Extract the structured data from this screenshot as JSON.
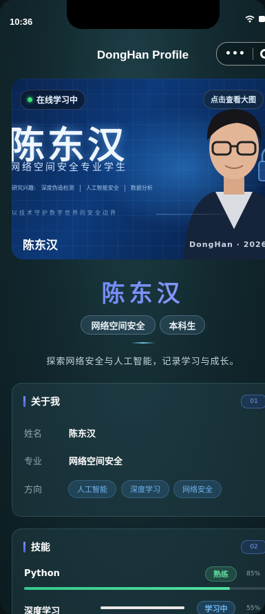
{
  "status_bar": {
    "time": "10:36",
    "icons": [
      "wifi-icon",
      "battery-icon"
    ]
  },
  "nav": {
    "title": "DongHan Profile",
    "menu_icon": "more-dots-icon",
    "close_icon": "target-icon"
  },
  "banner": {
    "status_badge": "在线学习中",
    "view_button": "点击查看大图",
    "big_name": "陈东汉",
    "subtitle": "网络空间安全专业学生",
    "interests_label": "研究兴趣:",
    "interests": [
      "深度伪造检测",
      "人工智能安全",
      "数据分析"
    ],
    "motto": "以技术守护数字世界的安全边界",
    "name_caption": "陈东汉",
    "signature": "DongHan · 2026"
  },
  "profile": {
    "name": "陈东汉",
    "tags": [
      "网络空间安全",
      "本科生"
    ],
    "slogan": "探索网络安全与人工智能，记录学习与成长。"
  },
  "about": {
    "title": "关于我",
    "number": "01",
    "rows": [
      {
        "label": "姓名",
        "value": "陈东汉"
      },
      {
        "label": "专业",
        "value": "网络空间安全"
      }
    ],
    "direction_label": "方向",
    "directions": [
      "人工智能",
      "深度学习",
      "网络安全"
    ]
  },
  "skills": {
    "title": "技能",
    "number": "02",
    "items": [
      {
        "name": "Python",
        "level": "熟练",
        "percent_label": "85%",
        "progress": 0.85
      },
      {
        "name": "深度学习",
        "level": "学习中",
        "percent_label": "55%",
        "progress": 0.55
      }
    ]
  },
  "colors": {
    "accent": "#6f7ff5",
    "online_dot": "#39e07a",
    "progress": "#43d592"
  }
}
